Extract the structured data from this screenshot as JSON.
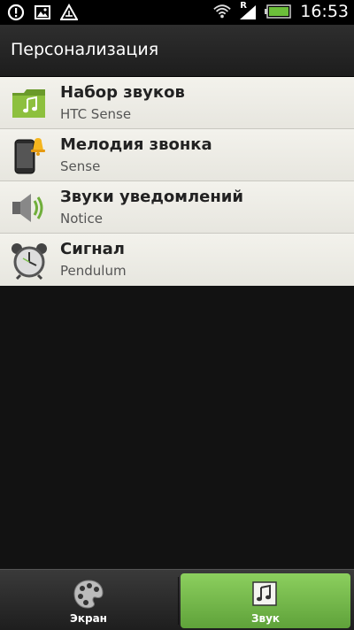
{
  "status_bar": {
    "time": "16:53",
    "signal_letter": "R",
    "icons": [
      "alert-icon",
      "image-icon",
      "triangle-warning-icon",
      "wifi-icon",
      "signal-icon",
      "battery-icon"
    ],
    "battery_level": 0.9
  },
  "header": {
    "title": "Персонализация"
  },
  "list": {
    "items": [
      {
        "icon": "folder-music-icon",
        "title": "Набор звуков",
        "subtitle": "HTC Sense"
      },
      {
        "icon": "phone-bell-icon",
        "title": "Мелодия звонка",
        "subtitle": "Sense"
      },
      {
        "icon": "speaker-icon",
        "title": "Звуки уведомлений",
        "subtitle": "Notice"
      },
      {
        "icon": "alarm-clock-icon",
        "title": "Сигнал",
        "subtitle": "Pendulum"
      }
    ]
  },
  "tabs": {
    "screen_label": "Экран",
    "sound_label": "Звук",
    "active": "Звук",
    "active_color": "#7bbf4c"
  }
}
